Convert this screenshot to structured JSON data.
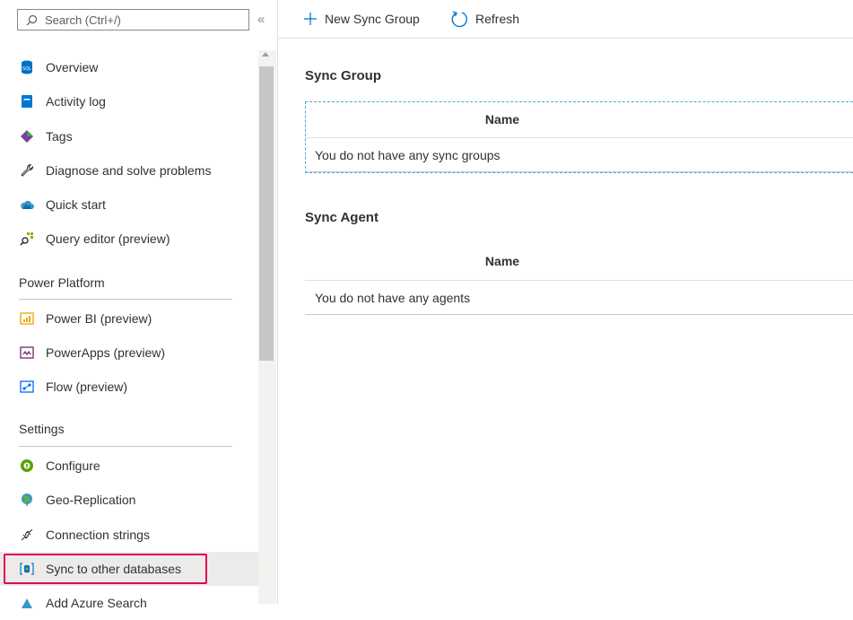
{
  "sidebar": {
    "search_placeholder": "Search (Ctrl+/)",
    "collapse_glyph": "«",
    "items": [
      {
        "label": "Overview",
        "icon": "sql-database-icon"
      },
      {
        "label": "Activity log",
        "icon": "activity-log-icon"
      },
      {
        "label": "Tags",
        "icon": "tag-icon"
      },
      {
        "label": "Diagnose and solve problems",
        "icon": "wrench-icon"
      },
      {
        "label": "Quick start",
        "icon": "cloud-icon"
      },
      {
        "label": "Query editor (preview)",
        "icon": "query-editor-icon"
      },
      {
        "label": "Power BI (preview)",
        "icon": "power-bi-icon"
      },
      {
        "label": "PowerApps (preview)",
        "icon": "powerapps-icon"
      },
      {
        "label": "Flow (preview)",
        "icon": "flow-icon"
      },
      {
        "label": "Configure",
        "icon": "configure-icon"
      },
      {
        "label": "Geo-Replication",
        "icon": "globe-icon"
      },
      {
        "label": "Connection strings",
        "icon": "connection-plug-icon"
      },
      {
        "label": "Sync to other databases",
        "icon": "sync-database-icon",
        "selected": true
      },
      {
        "label": "Add Azure Search",
        "icon": "azure-search-icon"
      }
    ],
    "sections": {
      "power_platform": "Power Platform",
      "settings": "Settings"
    }
  },
  "toolbar": {
    "new_sync_group": "New Sync Group",
    "refresh": "Refresh"
  },
  "main": {
    "sync_group": {
      "heading": "Sync Group",
      "column": "Name",
      "empty_text": "You do not have any sync groups"
    },
    "sync_agent": {
      "heading": "Sync Agent",
      "column": "Name",
      "empty_text": "You do not have any agents"
    }
  },
  "colors": {
    "highlight": "#e3004f",
    "selected_bg": "#edebe9",
    "accent": "#0078d4"
  }
}
